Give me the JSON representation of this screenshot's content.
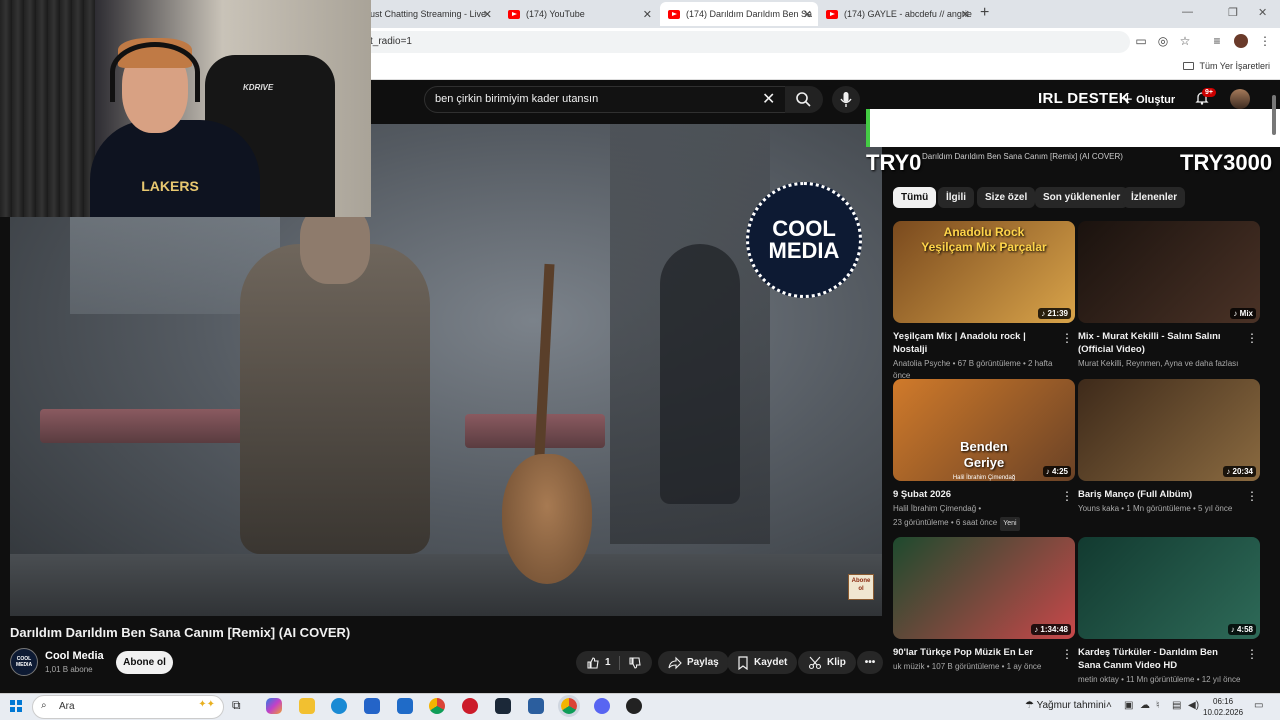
{
  "browser": {
    "tabs": [
      {
        "title": "ust Chatting Streaming - Live",
        "active": false
      },
      {
        "title": "(174) YouTube",
        "active": false
      },
      {
        "title": "(174) Darıldım Darıldım Ben Sa",
        "active": true
      },
      {
        "title": "(174) GAYLE - abcdefu // angrie",
        "active": false
      }
    ],
    "new_tab": "+",
    "url": "t_radio=1",
    "bookmarks_all": "Tüm Yer İşaretleri"
  },
  "youtube": {
    "search_query": "ben çirkin birimiyim kader utansın",
    "irl_label": "IRL DESTEK",
    "create_label": "Oluştur",
    "notif_count": "9+"
  },
  "webcam": {
    "shirt_text": "LAKERS",
    "chair_brand": "KDRIVE"
  },
  "video": {
    "title": "Darıldım Darıldım Ben Sana Canım [Remix] (AI COVER)",
    "logo_line1": "COOL",
    "logo_line2": "MEDIA",
    "watermark": "Abone ol",
    "channel_avatar_text": "COOL MEDIA",
    "channel_name": "Cool Media",
    "subscribers": "1,01 B abone",
    "subscribe_label": "Abone ol",
    "likes": "1",
    "share_label": "Paylaş",
    "save_label": "Kaydet",
    "clip_label": "Klip"
  },
  "ticker": {
    "left_value": "TRY0",
    "right_value": "TRY3000",
    "text": "Darıldım Darıldım Ben Sana Canım [Remix] (AI COVER)"
  },
  "chips": [
    "Tümü",
    "İlgili",
    "Size özel",
    "Son yüklenenler",
    "İzlenenler"
  ],
  "recommendations": [
    {
      "title": "Yeşilçam Mix | Anadolu rock | Nostalji",
      "meta1": "Anatolia Psyche • 67 B görüntüleme • 2 hafta önce",
      "meta2": "",
      "duration": "21:39",
      "thumb_text": "Anadolu Rock\nYeşilçam Mix Parçalar",
      "colors": [
        "#7a4a1e",
        "#d9a44a"
      ]
    },
    {
      "title": "Mix - Murat Kekilli - Salını Salını (Official Video)",
      "meta1": "Murat Kekilli, Reynmen, Ayna ve daha fazlası",
      "meta2": "",
      "duration": "Mix",
      "thumb_text": "",
      "colors": [
        "#1a120e",
        "#4a3226"
      ]
    },
    {
      "title": "9 Şubat 2026",
      "meta1": "Halil İbrahim Çimendağ •",
      "meta2": "23 görüntüleme • 6 saat önce",
      "badge": "Yeni",
      "duration": "4:25",
      "thumb_text": "Benden\nGeriye",
      "thumb_sub": "Halil İbrahim Çimendağ",
      "colors": [
        "#d07a2a",
        "#6a4226"
      ]
    },
    {
      "title": "Bariş Manço (Full Albüm)",
      "meta1": "Youns kaka • 1 Mn görüntüleme • 5 yıl önce",
      "meta2": "",
      "duration": "20:34",
      "thumb_text": "",
      "colors": [
        "#3e2a1a",
        "#8a6a40"
      ]
    },
    {
      "title": "90'lar Türkçe Pop Müzik En Ler",
      "meta1": "uk müzik • 107 B görüntüleme • 1 ay önce",
      "meta2": "",
      "duration": "1:34:48",
      "thumb_text": "",
      "colors": [
        "#1e4a2e",
        "#c8484a"
      ]
    },
    {
      "title": "Kardeş Türküler - Darıldım Ben Sana Canım Video HD",
      "meta1": "metin oktay • 11 Mn görüntüleme • 12 yıl önce",
      "meta2": "",
      "duration": "4:58",
      "thumb_text": "",
      "colors": [
        "#123a30",
        "#2e6a58"
      ]
    }
  ],
  "taskbar": {
    "search_placeholder": "Ara",
    "weather": "Yağmur tahmini",
    "time": "06:16",
    "date": "10.02.2026"
  }
}
